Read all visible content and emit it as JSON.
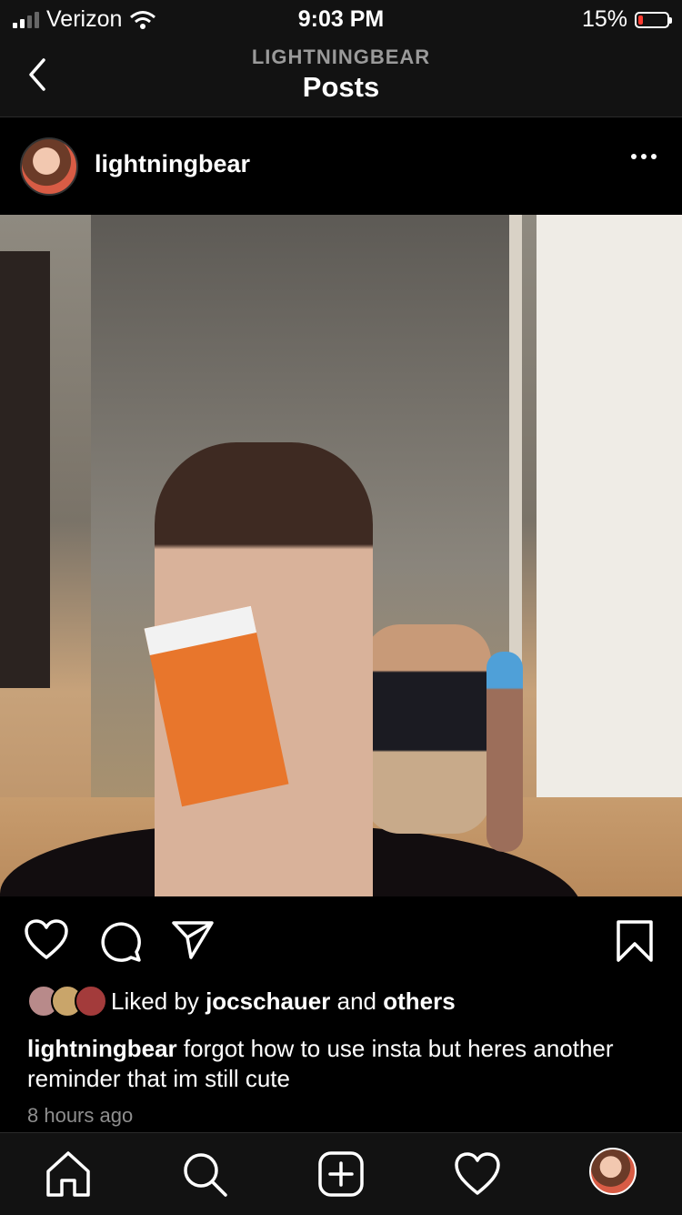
{
  "status_bar": {
    "carrier": "Verizon",
    "time": "9:03 PM",
    "battery": "15%",
    "battery_level": 0.15,
    "battery_color": "#ff3b30"
  },
  "header": {
    "subtitle": "LIGHTNINGBEAR",
    "title": "Posts"
  },
  "post": {
    "username": "lightningbear",
    "likes": {
      "prefix": "Liked by",
      "user": "jocschauer",
      "joiner": "and",
      "others": "others"
    },
    "caption": {
      "username": "lightningbear",
      "text": "forgot how to use insta but heres another reminder that im still cute"
    },
    "timestamp": "8 hours ago"
  },
  "icons": {
    "back": "chevron-left-icon",
    "more": "ellipsis-icon",
    "like": "heart-icon",
    "comment": "comment-icon",
    "share": "send-icon",
    "save": "bookmark-icon",
    "tabs": [
      "home-icon",
      "search-icon",
      "add-post-icon",
      "activity-heart-icon",
      "profile-avatar"
    ]
  }
}
